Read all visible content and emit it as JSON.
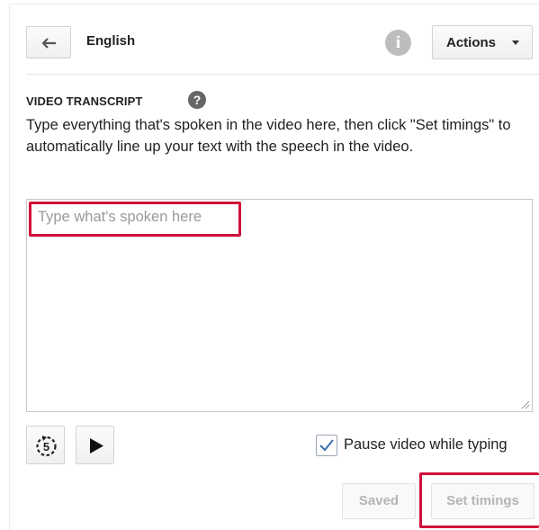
{
  "header": {
    "back_icon": "left-arrow-icon",
    "language": "English",
    "info_icon": "info-icon",
    "info_glyph": "i",
    "actions_label": "Actions"
  },
  "transcript": {
    "section_title": "VIDEO TRANSCRIPT",
    "help_glyph": "?",
    "instructions": "Type everything that's spoken in the video here, then click \"Set timings\" to automatically line up your text with the speech in the video.",
    "placeholder": "Type what's spoken here",
    "value": ""
  },
  "controls": {
    "replay_icon": "replay-5-seconds-icon",
    "play_icon": "play-icon",
    "pause_while_typing_checked": true,
    "pause_while_typing_label": "Pause video while typing"
  },
  "footer": {
    "saved_label": "Saved",
    "set_timings_label": "Set timings"
  },
  "colors": {
    "highlight": "#d0103a",
    "disabled_text": "#b5b5b5",
    "info_icon_bg": "#bdbdbd",
    "help_icon_bg": "#666666"
  }
}
